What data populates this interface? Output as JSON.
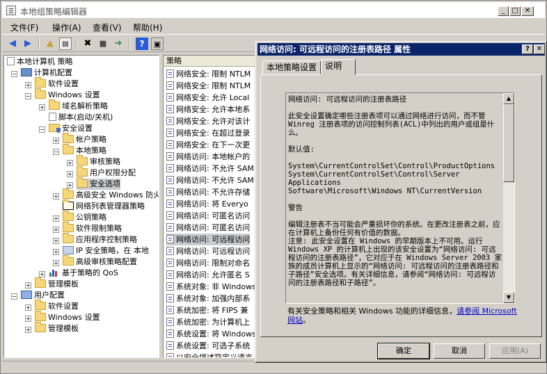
{
  "main_window": {
    "title": "本地组策略编辑器",
    "controls": [
      "_",
      "□",
      "✕"
    ]
  },
  "menu": {
    "file": "文件(F)",
    "action": "操作(A)",
    "view": "查看(V)",
    "help": "帮助(H)"
  },
  "tree": {
    "root": "本地计算机 策略",
    "computer_config": "计算机配置",
    "software_settings": "软件设置",
    "windows_settings": "Windows 设置",
    "name_resolution": "域名解析策略",
    "scripts": "脚本(启动/关机)",
    "security_settings": "安全设置",
    "account_policies": "帐户策略",
    "local_policies": "本地策略",
    "audit_policy": "审核策略",
    "user_rights": "用户权限分配",
    "security_options": "安全选项",
    "firewall": "高级安全 Windows 防火墙",
    "network_list": "网络列表管理器策略",
    "public_key": "公钥策略",
    "software_restriction": "软件限制策略",
    "app_control": "应用程序控制策略",
    "ip_security": "IP 安全策略，在 本地",
    "advanced_audit": "高级审核策略配置",
    "qos": "基于策略的 QoS",
    "admin_templates": "管理模板",
    "user_config": "用户配置",
    "u_software_settings": "软件设置",
    "u_windows_settings": "Windows 设置",
    "u_admin_templates": "管理模板"
  },
  "list": {
    "header": "策略",
    "rows": [
      "网络安全: 限制 NTLM",
      "网络安全: 限制 NTLM",
      "网络安全: 允许 Local",
      "网络安全: 允许本地系",
      "网络安全: 允许对该计",
      "网络安全: 在超过登录",
      "网络安全: 在下一次更",
      "网络访问: 本地帐户的",
      "网络访问: 不允许 SAM",
      "网络访问: 不允许 SAM",
      "网络访问: 不允许存储",
      "网络访问: 将 Everyo",
      "网络访问: 可匿名访问",
      "网络访问: 可匿名访问",
      "网络访问: 可远程访问",
      "网络访问: 可远程访问",
      "网络访问: 限制对命名",
      "网络访问: 允许匿名 S",
      "系统对象: 非 Windows",
      "系统对象: 加强内部系",
      "系统加密: 将 FIPS 兼",
      "系统加密: 为计算机上",
      "系统设置: 将 Windows",
      "系统设置: 可选子系统",
      "以安全描述符定义语言"
    ],
    "selected_index": 14
  },
  "dialog": {
    "title": "网络访问: 可远程访问的注册表路径 属性",
    "tabs": [
      "本地策略设置",
      "说明"
    ],
    "active_tab": 1,
    "explain_text": "网络访问: 可远程访问的注册表路径\n\n此安全设置确定哪些注册表项可以通过网络进行访问，而不管 Winreg 注册表项的访问控制列表(ACL)中列出的用户或组是什么。\n\n默认值:\n\nSystem\\CurrentControlSet\\Control\\ProductOptions\nSystem\\CurrentControlSet\\Control\\Server Applications\nSoftware\\Microsoft\\Windows NT\\CurrentVersion\n\n警告\n\n编辑注册表不当可能会严重损坏你的系统。在更改注册表之前，应在计算机上备份任何有价值的数据。\n注意: 此安全设置在 Windows 的早期版本上不可用。运行 Windows XP 的计算机上出现的该安全设置为“网络访问: 可远程访问的注册表路径”，它对应于在 Windows Server 2003 家族的成员计算机上显示的“网络访问: 可远程访问的注册表路径和子路径”安全选项。有关详细信息，请参阅“网络访问: 可远程访问的注册表路径和子路径”。",
    "more_info_prefix": "有关安全策略和相关 Windows 功能的详细信息，",
    "more_info_link": "请参阅 Microsoft 网站",
    "more_info_suffix": "。",
    "ok": "确定",
    "cancel": "取消",
    "apply": "应用(A)",
    "title_help": "?",
    "title_close": "✕"
  },
  "icons": [
    "back-arrow-icon",
    "forward-arrow-icon",
    "up-folder-icon",
    "show-tree-icon",
    "delete-icon",
    "properties-icon",
    "export-icon",
    "help-icon",
    "console-icon"
  ]
}
